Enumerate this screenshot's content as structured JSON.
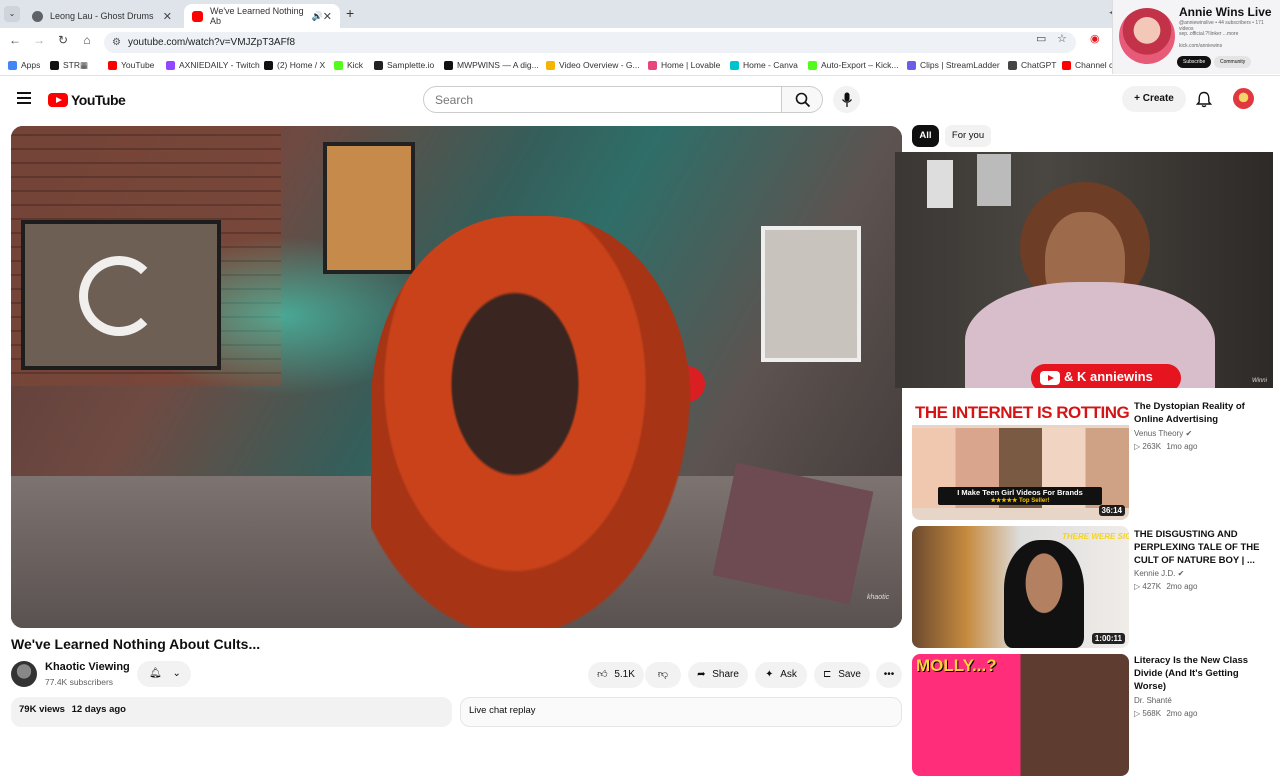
{
  "browser": {
    "tabs": [
      {
        "title": "Leong Lau - Ghost Drums",
        "favicon_color": "#5f6368"
      },
      {
        "title": "We've Learned Nothing Ab",
        "favicon_color": "#ff0000",
        "active": true
      }
    ],
    "url": "youtube.com/watch?v=VMJZpT3AFf8",
    "bookmarks": [
      {
        "label": "Apps",
        "color": "#4285f4"
      },
      {
        "label": "STR",
        "color": "#111111"
      },
      {
        "label": "YouTube",
        "color": "#ff0000"
      },
      {
        "label": "AXNIEDAILY - Twitch",
        "color": "#9146ff"
      },
      {
        "label": "(2) Home / X",
        "color": "#111111"
      },
      {
        "label": "Kick",
        "color": "#53fc18"
      },
      {
        "label": "Samplette.io",
        "color": "#222222"
      },
      {
        "label": "MWPWINS — A dig...",
        "color": "#111111"
      },
      {
        "label": "Video Overview - G...",
        "color": "#f4b400"
      },
      {
        "label": "Home | Lovable",
        "color": "#e8457a"
      },
      {
        "label": "Home - Canva",
        "color": "#00c4cc"
      },
      {
        "label": "Auto-Export – Kick...",
        "color": "#53fc18"
      },
      {
        "label": "Clips | StreamLadder",
        "color": "#6c5ce7"
      },
      {
        "label": "ChatGPT",
        "color": "#444444"
      },
      {
        "label": "Channel conten...",
        "color": "#ff0000"
      }
    ]
  },
  "overlay_profile": {
    "name": "Annie Wins Live",
    "meta": "@anniewinslive • 44 subscribers • 171 videos",
    "desc": "sep..official.?!linker ...more",
    "link": "kick.com/anniewins",
    "subscribe_label": "Subscribe",
    "community_label": "Community"
  },
  "youtube": {
    "logo_text": "YouTube",
    "search_placeholder": "Search",
    "create_label": "Create",
    "accent": "#ff0000"
  },
  "video": {
    "title": "We've Learned Nothing About Cults...",
    "channel": "Khaotic Viewing",
    "subscribers": "77.4K subscribers",
    "likes": "5.1K",
    "share_label": "Share",
    "ask_label": "Ask",
    "save_label": "Save",
    "views": "79K views",
    "age": "12 days ago",
    "chat_replay_label": "Live chat replay",
    "watermark": "khaotic"
  },
  "sidebar": {
    "chips": [
      "All",
      "For you"
    ],
    "cam_banner": "& K anniewins",
    "cam_watermark": "Winni",
    "recommendations": [
      {
        "title": "The Dystopian Reality of Online Advertising",
        "channel": "Venus Theory",
        "verified": true,
        "views": "263K",
        "age": "1mo ago",
        "duration": "36:14",
        "thumb_text": "THE INTERNET IS ROTTING",
        "thumb_caption": "I Make Teen Girl Videos For Brands",
        "thumb_caption2": "★★★★★ Top Seller!"
      },
      {
        "title": "THE DISGUSTING AND PERPLEXING TALE OF THE CULT OF NATURE BOY | ...",
        "channel": "Kennie J.D.",
        "verified": true,
        "views": "427K",
        "age": "2mo ago",
        "duration": "1:00:11",
        "thumb_text": "THERE WERE SIGNS..."
      },
      {
        "title": "Literacy Is the New Class Divide (And It's Getting Worse)",
        "channel": "Dr. Shanté",
        "verified": false,
        "views": "568K",
        "age": "2mo ago",
        "thumb_text": "MOLLY...?"
      }
    ]
  }
}
